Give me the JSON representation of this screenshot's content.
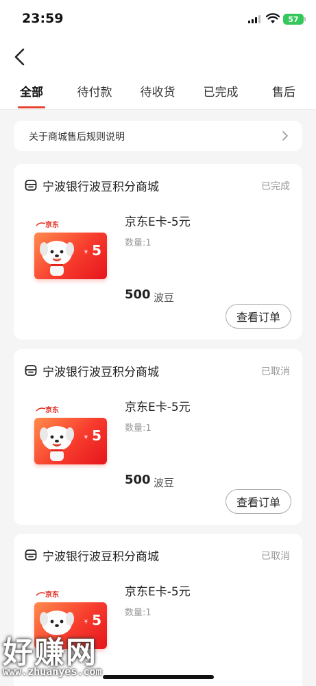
{
  "status_bar": {
    "time": "23:59",
    "battery": "57"
  },
  "tabs": [
    {
      "label": "全部",
      "active": true
    },
    {
      "label": "待付款",
      "active": false
    },
    {
      "label": "待收货",
      "active": false
    },
    {
      "label": "已完成",
      "active": false
    },
    {
      "label": "售后",
      "active": false
    }
  ],
  "rules_link": {
    "label": "关于商城售后规则说明"
  },
  "orders": [
    {
      "shop_name": "宁波银行波豆积分商城",
      "status": "已完成",
      "product_name": "京东E卡-5元",
      "quantity": "数量:1",
      "price": "500",
      "price_unit": "波豆",
      "button": "查看订单",
      "card_brand": "京东",
      "card_value": "5",
      "card_yen": "¥"
    },
    {
      "shop_name": "宁波银行波豆积分商城",
      "status": "已取消",
      "product_name": "京东E卡-5元",
      "quantity": "数量:1",
      "price": "500",
      "price_unit": "波豆",
      "button": "查看订单",
      "card_brand": "京东",
      "card_value": "5",
      "card_yen": "¥"
    },
    {
      "shop_name": "宁波银行波豆积分商城",
      "status": "已取消",
      "product_name": "京东E卡-5元",
      "quantity": "数量:1",
      "card_brand": "京东",
      "card_value": "5",
      "card_yen": "¥"
    }
  ],
  "watermark": {
    "title": "好赚网",
    "url": "www.zhuanyes.com"
  },
  "colors": {
    "accent": "#e8432e",
    "card_red": "#f73b2d",
    "battery": "#34c759"
  }
}
